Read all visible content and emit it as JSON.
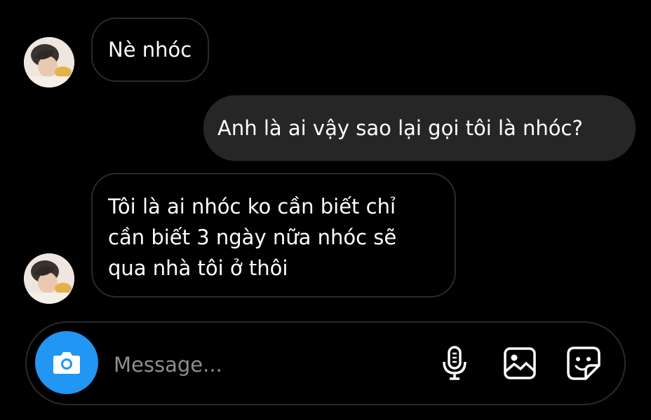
{
  "conversation": {
    "messages": [
      {
        "sender": "other",
        "text": "Nè nhóc"
      },
      {
        "sender": "me",
        "text": "Anh là ai vậy sao lại gọi tôi là nhóc?"
      },
      {
        "sender": "other",
        "lines": [
          "Tôi là ai nhóc ko cần biết chỉ",
          "cần biết 3 ngày nữa nhóc sẽ",
          "qua nhà tôi ở thôi"
        ]
      }
    ]
  },
  "composer": {
    "placeholder": "Message...",
    "value": "",
    "camera_icon": "camera-icon",
    "mic_icon": "microphone-icon",
    "gallery_icon": "image-icon",
    "sticker_icon": "sticker-icon"
  },
  "colors": {
    "background": "#000000",
    "outgoing_bubble": "#262626",
    "incoming_border": "#2a2a2a",
    "camera_button": "#2196f3",
    "placeholder_text": "#8e8e8e"
  }
}
